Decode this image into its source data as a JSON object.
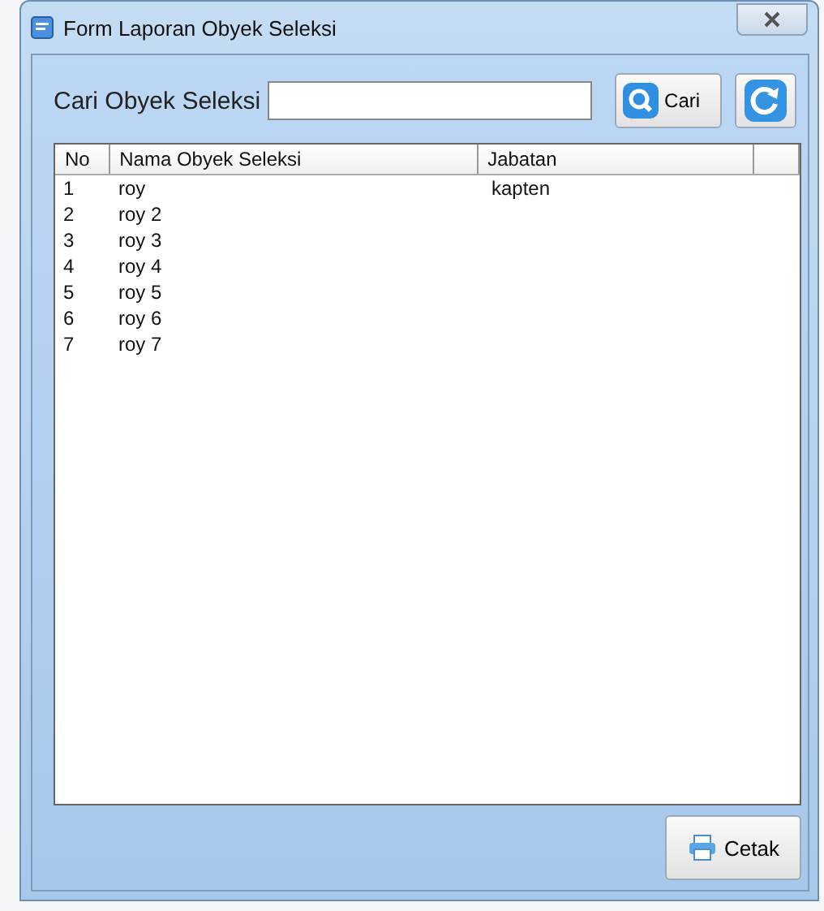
{
  "window": {
    "title": "Form Laporan Obyek Seleksi"
  },
  "search": {
    "label": "Cari Obyek Seleksi",
    "button": "Cari"
  },
  "table": {
    "columns": [
      "No",
      "Nama Obyek Seleksi",
      "Jabatan"
    ],
    "rows": [
      [
        "1",
        "roy",
        "kapten"
      ],
      [
        "2",
        "roy 2",
        ""
      ],
      [
        "3",
        "roy 3",
        ""
      ],
      [
        "4",
        "roy 4",
        ""
      ],
      [
        "5",
        "roy 5",
        ""
      ],
      [
        "6",
        "roy 6",
        ""
      ],
      [
        "7",
        "roy 7",
        ""
      ]
    ]
  },
  "print_button": "Cetak"
}
